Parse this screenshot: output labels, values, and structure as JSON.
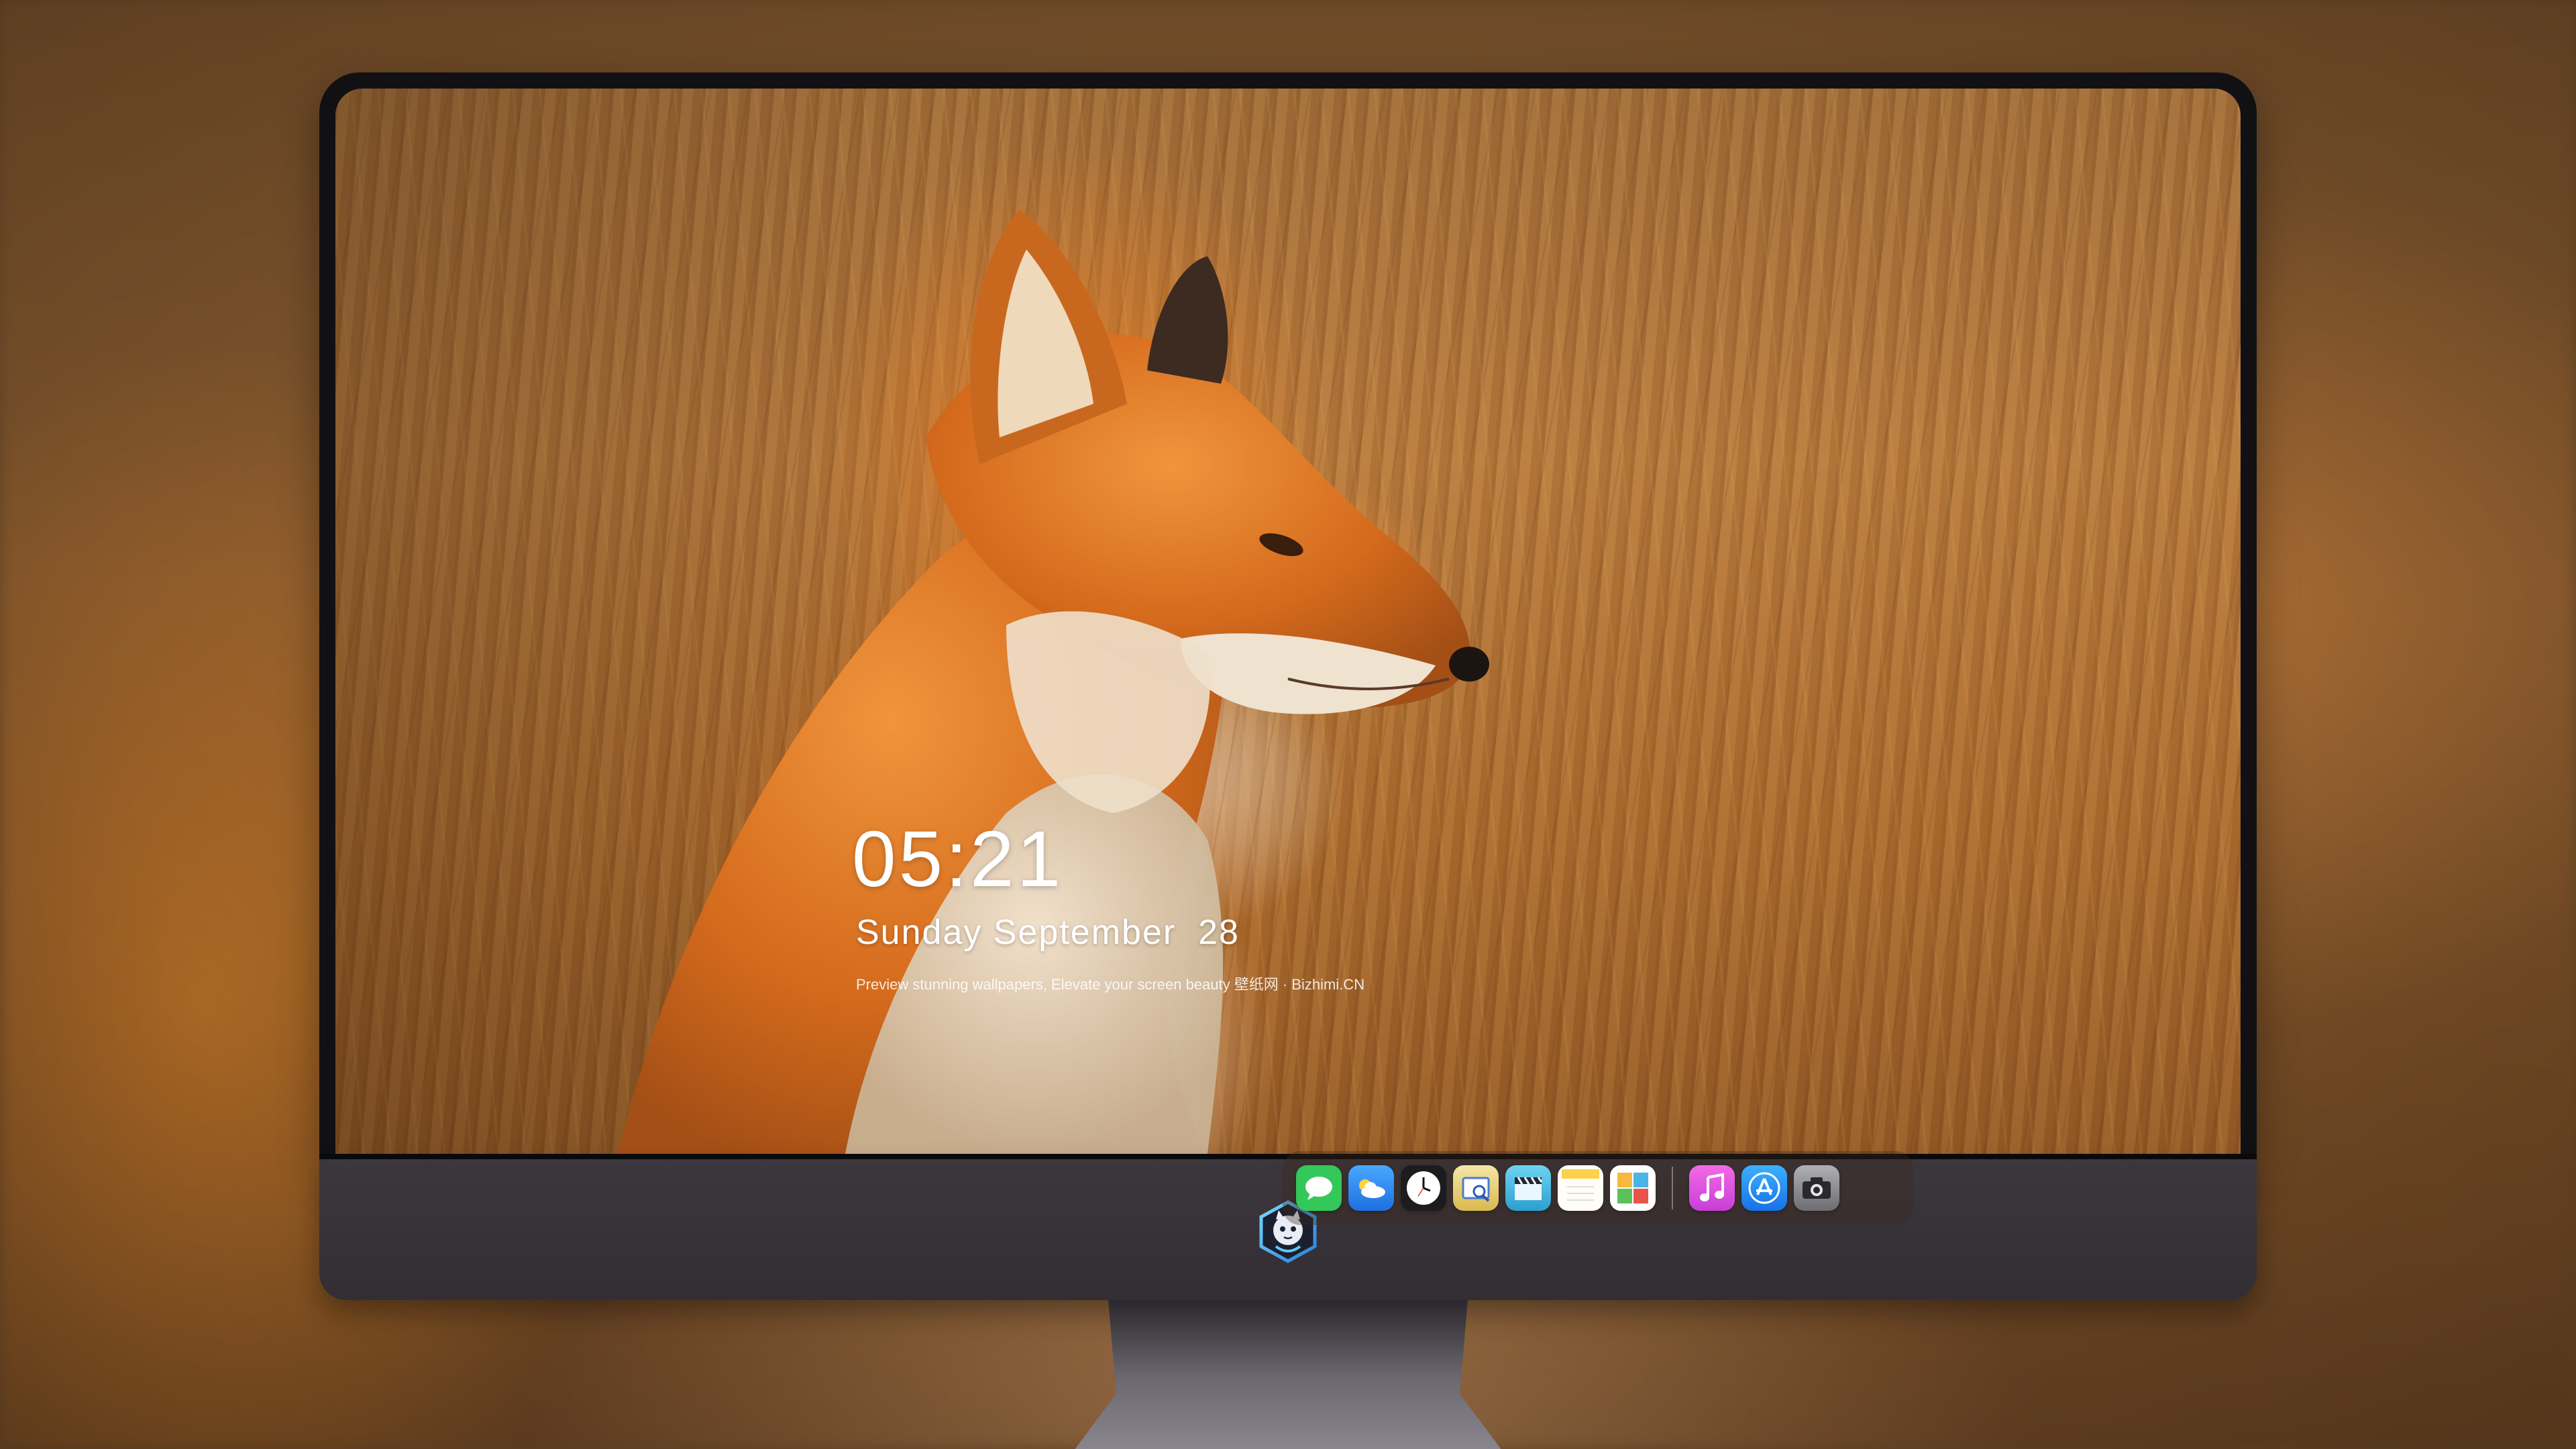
{
  "lockscreen": {
    "time": "05:21",
    "date": "Sunday September  28",
    "tagline": "Preview stunning wallpapers, Elevate your screen beauty  壁纸网 · Bizhimi.CN"
  },
  "dock": {
    "apps": [
      {
        "name": "Messages",
        "icon": "messages-icon",
        "color": "#34c759"
      },
      {
        "name": "Weather",
        "icon": "weather-icon",
        "color": "#2f8bf0"
      },
      {
        "name": "Clock",
        "icon": "clock-icon",
        "color": "#1c1c1e"
      },
      {
        "name": "Preview",
        "icon": "preview-icon",
        "color": "#e9d27a"
      },
      {
        "name": "Clips",
        "icon": "clapperboard-icon",
        "color": "#3fa9d8"
      },
      {
        "name": "Notes",
        "icon": "notes-icon",
        "color": "#fbe07a"
      },
      {
        "name": "Photos",
        "icon": "photos-icon",
        "color": "#ffffff"
      },
      {
        "name": "Music",
        "icon": "music-icon",
        "color": "#e24bd8"
      },
      {
        "name": "App Store",
        "icon": "app-store-icon",
        "color": "#1e8cf2"
      },
      {
        "name": "Camera",
        "icon": "camera-icon",
        "color": "#8a8a8e"
      }
    ]
  },
  "chin": {
    "logo": "mascot-logo-icon"
  }
}
